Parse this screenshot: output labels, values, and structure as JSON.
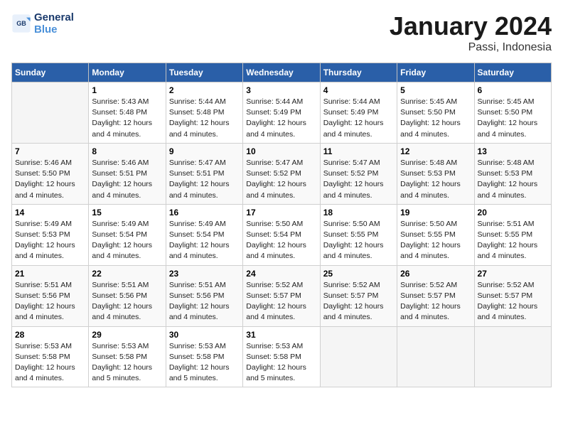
{
  "header": {
    "logo_line1": "General",
    "logo_line2": "Blue",
    "month": "January 2024",
    "location": "Passi, Indonesia"
  },
  "columns": [
    "Sunday",
    "Monday",
    "Tuesday",
    "Wednesday",
    "Thursday",
    "Friday",
    "Saturday"
  ],
  "weeks": [
    [
      {
        "day": "",
        "info": ""
      },
      {
        "day": "1",
        "info": "Sunrise: 5:43 AM\nSunset: 5:48 PM\nDaylight: 12 hours\nand 4 minutes."
      },
      {
        "day": "2",
        "info": "Sunrise: 5:44 AM\nSunset: 5:48 PM\nDaylight: 12 hours\nand 4 minutes."
      },
      {
        "day": "3",
        "info": "Sunrise: 5:44 AM\nSunset: 5:49 PM\nDaylight: 12 hours\nand 4 minutes."
      },
      {
        "day": "4",
        "info": "Sunrise: 5:44 AM\nSunset: 5:49 PM\nDaylight: 12 hours\nand 4 minutes."
      },
      {
        "day": "5",
        "info": "Sunrise: 5:45 AM\nSunset: 5:50 PM\nDaylight: 12 hours\nand 4 minutes."
      },
      {
        "day": "6",
        "info": "Sunrise: 5:45 AM\nSunset: 5:50 PM\nDaylight: 12 hours\nand 4 minutes."
      }
    ],
    [
      {
        "day": "7",
        "info": "Sunrise: 5:46 AM\nSunset: 5:50 PM\nDaylight: 12 hours\nand 4 minutes."
      },
      {
        "day": "8",
        "info": "Sunrise: 5:46 AM\nSunset: 5:51 PM\nDaylight: 12 hours\nand 4 minutes."
      },
      {
        "day": "9",
        "info": "Sunrise: 5:47 AM\nSunset: 5:51 PM\nDaylight: 12 hours\nand 4 minutes."
      },
      {
        "day": "10",
        "info": "Sunrise: 5:47 AM\nSunset: 5:52 PM\nDaylight: 12 hours\nand 4 minutes."
      },
      {
        "day": "11",
        "info": "Sunrise: 5:47 AM\nSunset: 5:52 PM\nDaylight: 12 hours\nand 4 minutes."
      },
      {
        "day": "12",
        "info": "Sunrise: 5:48 AM\nSunset: 5:53 PM\nDaylight: 12 hours\nand 4 minutes."
      },
      {
        "day": "13",
        "info": "Sunrise: 5:48 AM\nSunset: 5:53 PM\nDaylight: 12 hours\nand 4 minutes."
      }
    ],
    [
      {
        "day": "14",
        "info": "Sunrise: 5:49 AM\nSunset: 5:53 PM\nDaylight: 12 hours\nand 4 minutes."
      },
      {
        "day": "15",
        "info": "Sunrise: 5:49 AM\nSunset: 5:54 PM\nDaylight: 12 hours\nand 4 minutes."
      },
      {
        "day": "16",
        "info": "Sunrise: 5:49 AM\nSunset: 5:54 PM\nDaylight: 12 hours\nand 4 minutes."
      },
      {
        "day": "17",
        "info": "Sunrise: 5:50 AM\nSunset: 5:54 PM\nDaylight: 12 hours\nand 4 minutes."
      },
      {
        "day": "18",
        "info": "Sunrise: 5:50 AM\nSunset: 5:55 PM\nDaylight: 12 hours\nand 4 minutes."
      },
      {
        "day": "19",
        "info": "Sunrise: 5:50 AM\nSunset: 5:55 PM\nDaylight: 12 hours\nand 4 minutes."
      },
      {
        "day": "20",
        "info": "Sunrise: 5:51 AM\nSunset: 5:55 PM\nDaylight: 12 hours\nand 4 minutes."
      }
    ],
    [
      {
        "day": "21",
        "info": "Sunrise: 5:51 AM\nSunset: 5:56 PM\nDaylight: 12 hours\nand 4 minutes."
      },
      {
        "day": "22",
        "info": "Sunrise: 5:51 AM\nSunset: 5:56 PM\nDaylight: 12 hours\nand 4 minutes."
      },
      {
        "day": "23",
        "info": "Sunrise: 5:51 AM\nSunset: 5:56 PM\nDaylight: 12 hours\nand 4 minutes."
      },
      {
        "day": "24",
        "info": "Sunrise: 5:52 AM\nSunset: 5:57 PM\nDaylight: 12 hours\nand 4 minutes."
      },
      {
        "day": "25",
        "info": "Sunrise: 5:52 AM\nSunset: 5:57 PM\nDaylight: 12 hours\nand 4 minutes."
      },
      {
        "day": "26",
        "info": "Sunrise: 5:52 AM\nSunset: 5:57 PM\nDaylight: 12 hours\nand 4 minutes."
      },
      {
        "day": "27",
        "info": "Sunrise: 5:52 AM\nSunset: 5:57 PM\nDaylight: 12 hours\nand 4 minutes."
      }
    ],
    [
      {
        "day": "28",
        "info": "Sunrise: 5:53 AM\nSunset: 5:58 PM\nDaylight: 12 hours\nand 4 minutes."
      },
      {
        "day": "29",
        "info": "Sunrise: 5:53 AM\nSunset: 5:58 PM\nDaylight: 12 hours\nand 5 minutes."
      },
      {
        "day": "30",
        "info": "Sunrise: 5:53 AM\nSunset: 5:58 PM\nDaylight: 12 hours\nand 5 minutes."
      },
      {
        "day": "31",
        "info": "Sunrise: 5:53 AM\nSunset: 5:58 PM\nDaylight: 12 hours\nand 5 minutes."
      },
      {
        "day": "",
        "info": ""
      },
      {
        "day": "",
        "info": ""
      },
      {
        "day": "",
        "info": ""
      }
    ]
  ]
}
